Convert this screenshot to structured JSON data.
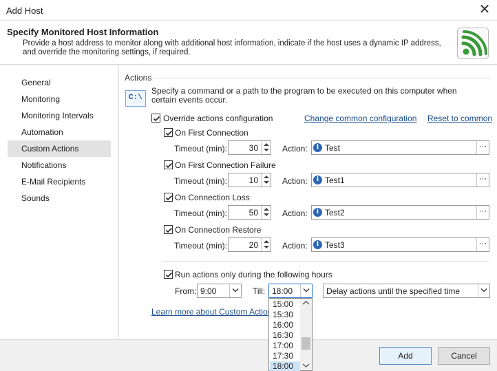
{
  "window": {
    "title": "Add Host",
    "close_label": "✕"
  },
  "header": {
    "title": "Specify Monitored Host Information",
    "description": "Provide a host address to monitor along with additional host information, indicate if the host uses a dynamic IP address, and override the monitoring settings, if required."
  },
  "nav": {
    "items": [
      {
        "label": "General"
      },
      {
        "label": "Monitoring"
      },
      {
        "label": "Monitoring Intervals"
      },
      {
        "label": "Automation"
      },
      {
        "label": "Custom Actions",
        "selected": true
      },
      {
        "label": "Notifications"
      },
      {
        "label": "E-Mail Recipients"
      },
      {
        "label": "Sounds"
      }
    ]
  },
  "actions": {
    "group_label": "Actions",
    "icon_text": "C:\\",
    "description": "Specify a command or a path to the program to be executed on this computer when certain events occur.",
    "override_label": "Override actions configuration",
    "change_common_link": "Change common configuration",
    "reset_link": "Reset to common",
    "timeout_label": "Timeout (min):",
    "action_label": "Action:",
    "events": [
      {
        "label": "On First Connection",
        "timeout": "30",
        "action": "Test"
      },
      {
        "label": "On First Connection Failure",
        "timeout": "10",
        "action": "Test1"
      },
      {
        "label": "On Connection Loss",
        "timeout": "50",
        "action": "Test2"
      },
      {
        "label": "On Connection Restore",
        "timeout": "20",
        "action": "Test3"
      }
    ],
    "hours_label": "Run actions only during the following hours",
    "from_label": "From:",
    "from_value": "9:00",
    "till_label": "Till:",
    "till_value": "18:00",
    "delay_value": "Delay actions until the specified time",
    "learn_more_link": "Learn more about Custom Actions",
    "till_options": [
      "15:00",
      "15:30",
      "16:00",
      "16:30",
      "17:00",
      "17:30",
      "18:00"
    ],
    "till_selected": "18:00"
  },
  "buttons": {
    "add": "Add",
    "cancel": "Cancel"
  },
  "colors": {
    "accent": "#1e6fd0",
    "link": "#1a4d8c",
    "logo_green": "#3a9a3a"
  }
}
